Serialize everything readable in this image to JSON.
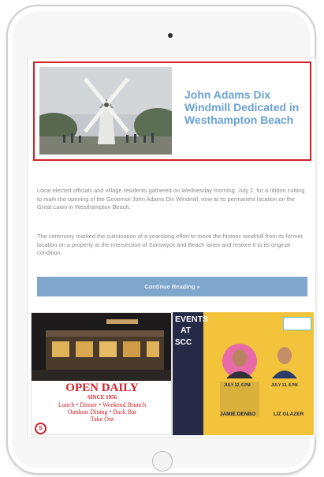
{
  "feature": {
    "title": "John Adams Dix Windmill Dedicated in Westhampton Beach",
    "image_alt": "windmill-photo"
  },
  "article": {
    "paragraph_1": "Local elected officials and village residents gathered on Wednesday morning, July 2, for a ribbon cutting to mark the opening of the Governor John Adams Dix Windmill, now at its permanent location on the Great Lawn in Westhampton Beach.",
    "paragraph_2": "The ceremony marked the culmination of a yearslong effort to move the historic windmill from its former location on a property at the intersection of Sunswyck and Beach lanes and restore it to its original condition.",
    "continue_label": "Continue Reading »"
  },
  "ads": {
    "left": {
      "headline": "OPEN DAILY",
      "since": "SINCE 1956",
      "line_1": "Lunch • Dinner • Weekend Brunch",
      "line_2": "Outdoor Dining • Back Bar",
      "line_3": "Take Out",
      "logo": "S"
    },
    "right": {
      "events": "EVENTS",
      "at": "AT",
      "venue": "SCC",
      "date_1": "JULY 12, 6 PM",
      "performer_1": "JAMIE DENBO",
      "date_2": "JULY 13, 8 PM",
      "performer_2": "LIZ GLAZER"
    }
  }
}
